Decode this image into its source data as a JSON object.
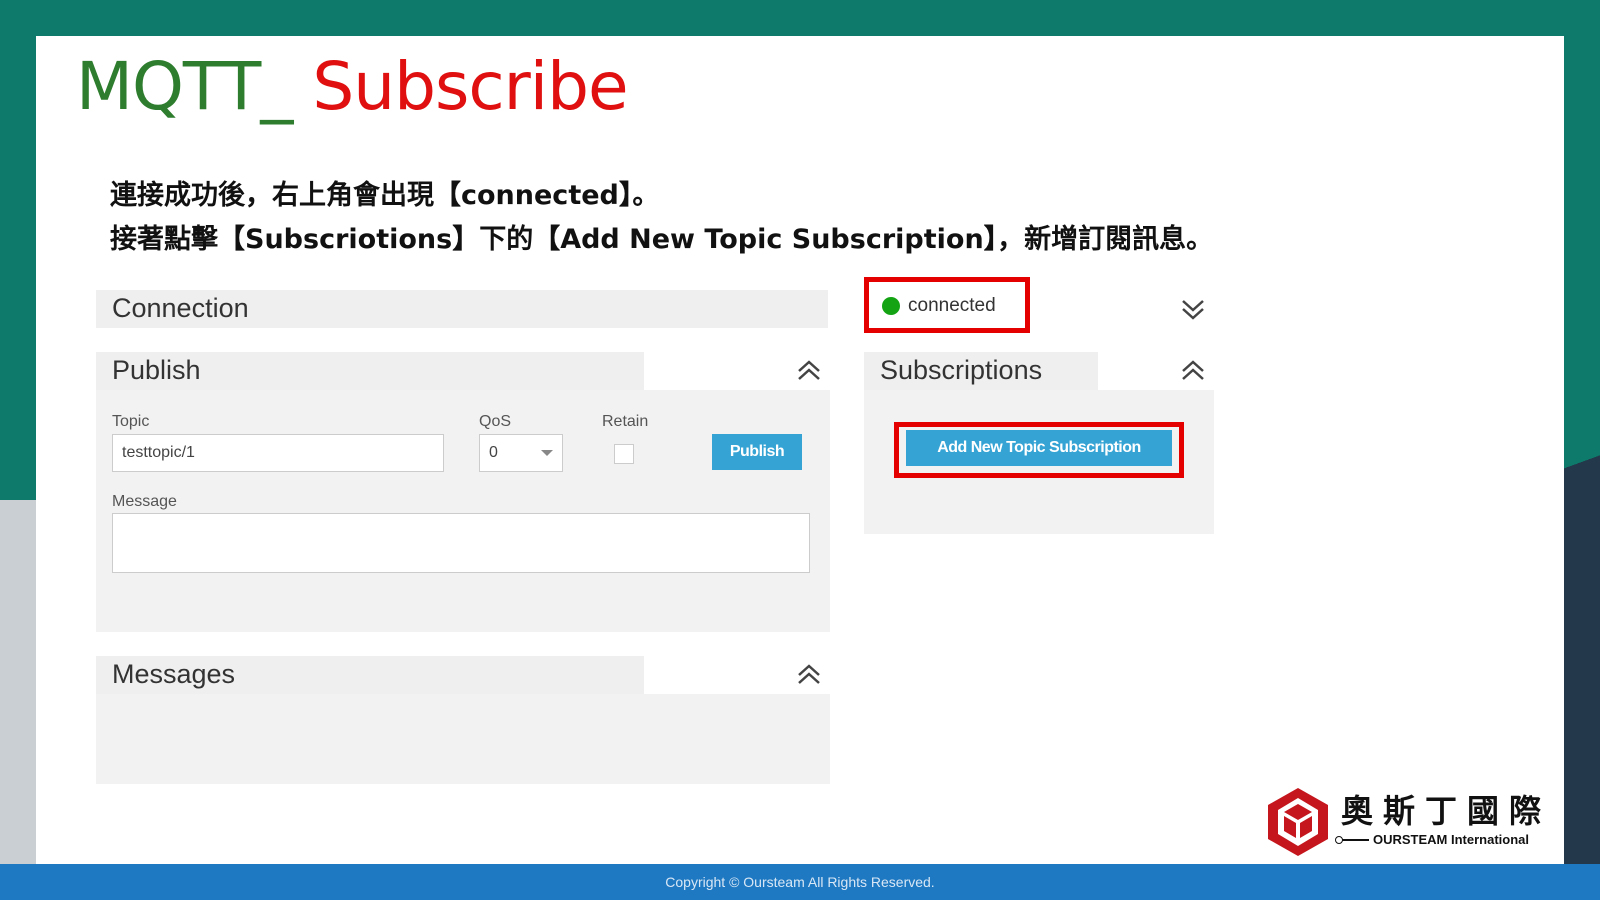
{
  "slide": {
    "title_part1": "MQTT_ ",
    "title_part2": "Subscribe",
    "line1": "連接成功後，右上角會出現【connected】。",
    "line2": "接著點擊【Subscriotions】下的【Add New Topic Subscription】，新增訂閱訊息。"
  },
  "connection": {
    "title": "Connection",
    "status": "connected",
    "status_color": "#13a313"
  },
  "publish": {
    "title": "Publish",
    "topic_label": "Topic",
    "topic_value": "testtopic/1",
    "qos_label": "QoS",
    "qos_value": "0",
    "retain_label": "Retain",
    "publish_button": "Publish",
    "message_label": "Message"
  },
  "subscriptions": {
    "title": "Subscriptions",
    "add_button": "Add New Topic Subscription"
  },
  "messages": {
    "title": "Messages"
  },
  "footer": {
    "copyright": "Copyright © Oursteam All Rights Reserved."
  },
  "logo": {
    "name_cn": "奧斯丁國際",
    "name_en": "OURSTEAM International"
  },
  "colors": {
    "accent_button": "#35a3d4",
    "highlight_red": "#e50000",
    "footer_blue": "#1f79c2",
    "title_green": "#2e7d2e",
    "title_red": "#e01010"
  }
}
